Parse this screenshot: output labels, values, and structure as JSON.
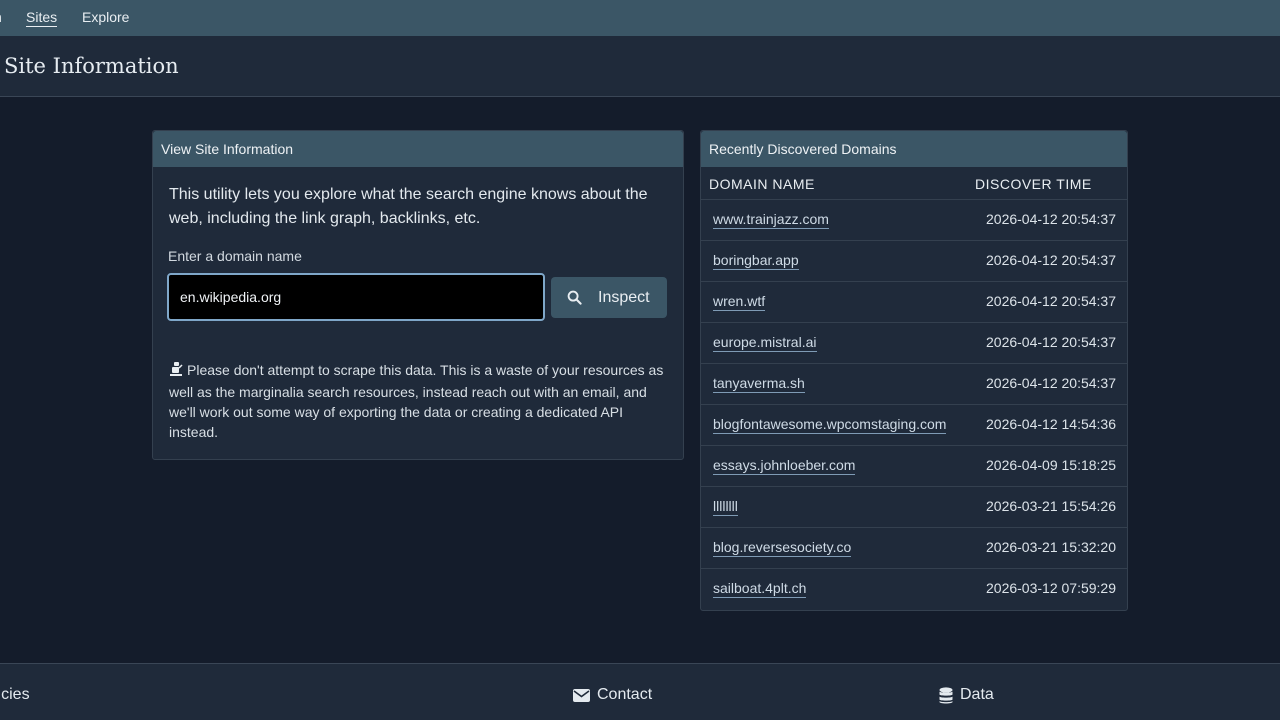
{
  "nav": {
    "cut_label": "n",
    "items": [
      {
        "label": "Sites",
        "active": true
      },
      {
        "label": "Explore",
        "active": false
      }
    ]
  },
  "page": {
    "title": "Site Information"
  },
  "view_card": {
    "header": "View Site Information",
    "intro": "This utility lets you explore what the search engine knows about the web, including the link graph, backlinks, etc.",
    "field_label": "Enter a domain name",
    "input_value": "en.wikipedia.org",
    "button_label": "Inspect",
    "notice": "Please don't attempt to scrape this data. This is a waste of your resources as well as the marginalia search resources, instead reach out with an email, and we'll work out some way of exporting the data or creating a dedicated API instead."
  },
  "recent_card": {
    "header": "Recently Discovered Domains",
    "columns": [
      "DOMAIN NAME",
      "DISCOVER TIME"
    ],
    "rows": [
      {
        "domain": "www.trainjazz.com",
        "time": "2026-04-12 20:54:37"
      },
      {
        "domain": "boringbar.app",
        "time": "2026-04-12 20:54:37"
      },
      {
        "domain": "wren.wtf",
        "time": "2026-04-12 20:54:37"
      },
      {
        "domain": "europe.mistral.ai",
        "time": "2026-04-12 20:54:37"
      },
      {
        "domain": "tanyaverma.sh",
        "time": "2026-04-12 20:54:37"
      },
      {
        "domain": "blogfontawesome.wpcomstaging.com",
        "time": "2026-04-12 14:54:36"
      },
      {
        "domain": "essays.johnloeber.com",
        "time": "2026-04-09 15:18:25"
      },
      {
        "domain": "llllllll",
        "time": "2026-03-21 15:54:26"
      },
      {
        "domain": "blog.reversesociety.co",
        "time": "2026-03-21 15:32:20"
      },
      {
        "domain": "sailboat.4plt.ch",
        "time": "2026-03-12 07:59:29"
      }
    ]
  },
  "footer": {
    "policies": "licies",
    "contact": "Contact",
    "data": "Data"
  },
  "icons": {
    "search": "magnifying-glass",
    "notice": "robot",
    "contact": "envelope",
    "data": "database"
  }
}
